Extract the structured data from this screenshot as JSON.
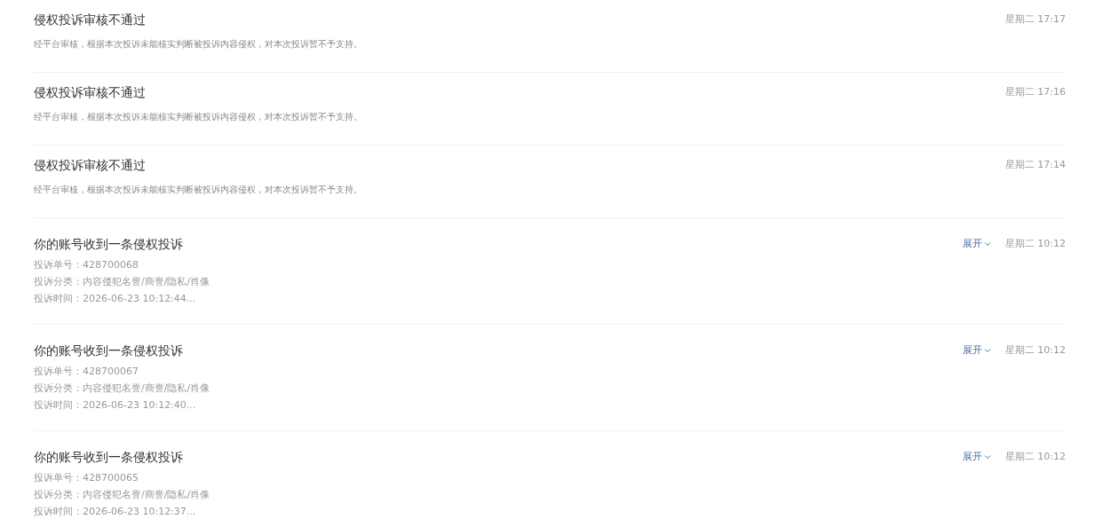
{
  "notifications": [
    {
      "kind": "notice",
      "title": "侵权投诉审核不通过",
      "time": "星期二 17:17",
      "description": "经平台审核，根据本次投诉未能核实判断被投诉内容侵权，对本次投诉暂不予支持。"
    },
    {
      "kind": "notice",
      "title": "侵权投诉审核不通过",
      "time": "星期二 17:16",
      "description": "经平台审核，根据本次投诉未能核实判断被投诉内容侵权，对本次投诉暂不予支持。"
    },
    {
      "kind": "notice",
      "title": "侵权投诉审核不通过",
      "time": "星期二 17:14",
      "description": "经平台审核，根据本次投诉未能核实判断被投诉内容侵权，对本次投诉暂不予支持。"
    },
    {
      "kind": "complaint",
      "title": "你的账号收到一条侵权投诉",
      "time": "星期二 10:12",
      "toggle": "展开",
      "expanded": false,
      "details": [
        "投诉单号：428700068",
        "投诉分类：内容侵犯名誉/商誉/隐私/肖像",
        "投诉时间：2026-06-23 10:12:44..."
      ]
    },
    {
      "kind": "complaint",
      "title": "你的账号收到一条侵权投诉",
      "time": "星期二 10:12",
      "toggle": "展开",
      "expanded": false,
      "details": [
        "投诉单号：428700067",
        "投诉分类：内容侵犯名誉/商誉/隐私/肖像",
        "投诉时间：2026-06-23 10:12:40..."
      ]
    },
    {
      "kind": "complaint",
      "title": "你的账号收到一条侵权投诉",
      "time": "星期二 10:12",
      "toggle": "展开",
      "expanded": false,
      "details": [
        "投诉单号：428700065",
        "投诉分类：内容侵犯名誉/商誉/隐私/肖像",
        "投诉时间：2026-06-23 10:12:37..."
      ]
    }
  ]
}
